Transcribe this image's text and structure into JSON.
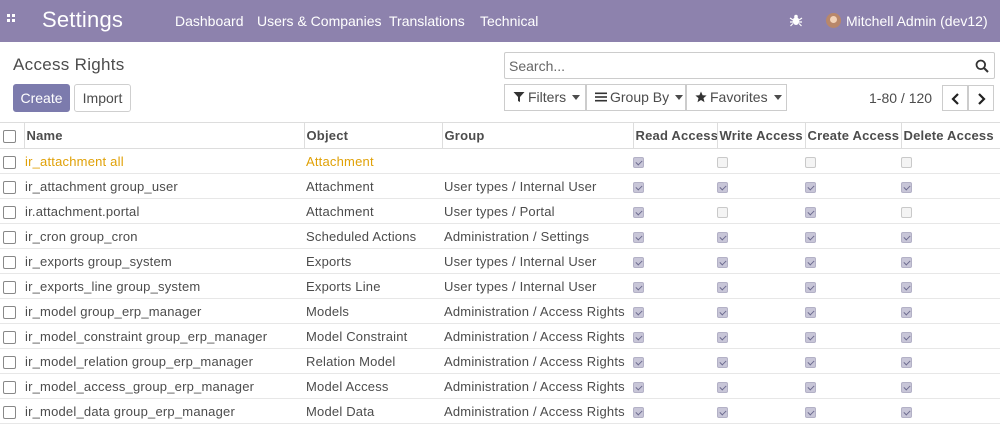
{
  "navbar": {
    "apps_icon": "apps-grid-icon",
    "brand": "Settings",
    "menu": [
      "Dashboard",
      "Users & Companies",
      "Translations",
      "Technical"
    ],
    "debug_icon": "bug-icon",
    "user": "Mitchell Admin (dev12)"
  },
  "control_panel": {
    "title": "Access Rights",
    "create_label": "Create",
    "import_label": "Import",
    "search_placeholder": "Search...",
    "filters_label": "Filters",
    "groupby_label": "Group By",
    "favorites_label": "Favorites",
    "pager": "1-80 / 120"
  },
  "table": {
    "columns": [
      "Name",
      "Object",
      "Group",
      "Read Access",
      "Write Access",
      "Create Access",
      "Delete Access"
    ],
    "rows": [
      {
        "name": "ir_attachment all",
        "object": "Attachment",
        "group": "",
        "read": true,
        "write": false,
        "create": false,
        "delete": false,
        "highlight": true
      },
      {
        "name": "ir_attachment group_user",
        "object": "Attachment",
        "group": "User types / Internal User",
        "read": true,
        "write": true,
        "create": true,
        "delete": true
      },
      {
        "name": "ir.attachment.portal",
        "object": "Attachment",
        "group": "User types / Portal",
        "read": true,
        "write": false,
        "create": true,
        "delete": false
      },
      {
        "name": "ir_cron group_cron",
        "object": "Scheduled Actions",
        "group": "Administration / Settings",
        "read": true,
        "write": true,
        "create": true,
        "delete": true
      },
      {
        "name": "ir_exports group_system",
        "object": "Exports",
        "group": "User types / Internal User",
        "read": true,
        "write": true,
        "create": true,
        "delete": true
      },
      {
        "name": "ir_exports_line group_system",
        "object": "Exports Line",
        "group": "User types / Internal User",
        "read": true,
        "write": true,
        "create": true,
        "delete": true
      },
      {
        "name": "ir_model group_erp_manager",
        "object": "Models",
        "group": "Administration / Access Rights",
        "read": true,
        "write": true,
        "create": true,
        "delete": true
      },
      {
        "name": "ir_model_constraint group_erp_manager",
        "object": "Model Constraint",
        "group": "Administration / Access Rights",
        "read": true,
        "write": true,
        "create": true,
        "delete": true
      },
      {
        "name": "ir_model_relation group_erp_manager",
        "object": "Relation Model",
        "group": "Administration / Access Rights",
        "read": true,
        "write": true,
        "create": true,
        "delete": true
      },
      {
        "name": "ir_model_access_group_erp_manager",
        "object": "Model Access",
        "group": "Administration / Access Rights",
        "read": true,
        "write": true,
        "create": true,
        "delete": true
      },
      {
        "name": "ir_model_data group_erp_manager",
        "object": "Model Data",
        "group": "Administration / Access Rights",
        "read": true,
        "write": true,
        "create": true,
        "delete": true
      }
    ]
  },
  "colors": {
    "navbar": "#8d82ad",
    "primary_button": "#7c7bad",
    "highlight_row_text": "#e0a107"
  }
}
